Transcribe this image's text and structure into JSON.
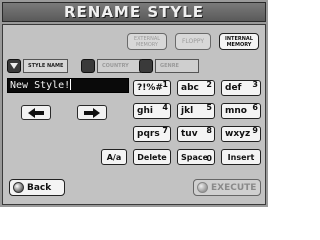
{
  "header": {
    "title": "RENAME STYLE"
  },
  "memory": {
    "external_label": "EXTERNAL MEMORY",
    "floppy_label": "FLOPPY",
    "internal_label": "INTERNAL MEMORY",
    "selected": "INTERNAL MEMORY"
  },
  "tabs": [
    {
      "label": "STYLE NAME",
      "selected": true
    },
    {
      "label": "COUNTRY",
      "selected": false
    },
    {
      "label": "GENRE",
      "selected": false
    }
  ],
  "name_field": {
    "value": "New Style!"
  },
  "keypad": {
    "keys": [
      {
        "chars": "?!%#",
        "num": "1"
      },
      {
        "chars": "abc",
        "num": "2"
      },
      {
        "chars": "def",
        "num": "3"
      },
      {
        "chars": "ghi",
        "num": "4"
      },
      {
        "chars": "jkl",
        "num": "5"
      },
      {
        "chars": "mno",
        "num": "6"
      },
      {
        "chars": "pqrs",
        "num": "7"
      },
      {
        "chars": "tuv",
        "num": "8"
      },
      {
        "chars": "wxyz",
        "num": "9"
      }
    ],
    "case_label": "A/a",
    "delete_label": "Delete",
    "space_label": "Space",
    "space_num": "0",
    "insert_label": "Insert"
  },
  "footer": {
    "back_label": "Back",
    "execute_label": "EXECUTE"
  },
  "icons": {
    "left": "arrow-left-icon",
    "right": "arrow-right-icon",
    "tab_selector": "triangle-down-icon"
  }
}
